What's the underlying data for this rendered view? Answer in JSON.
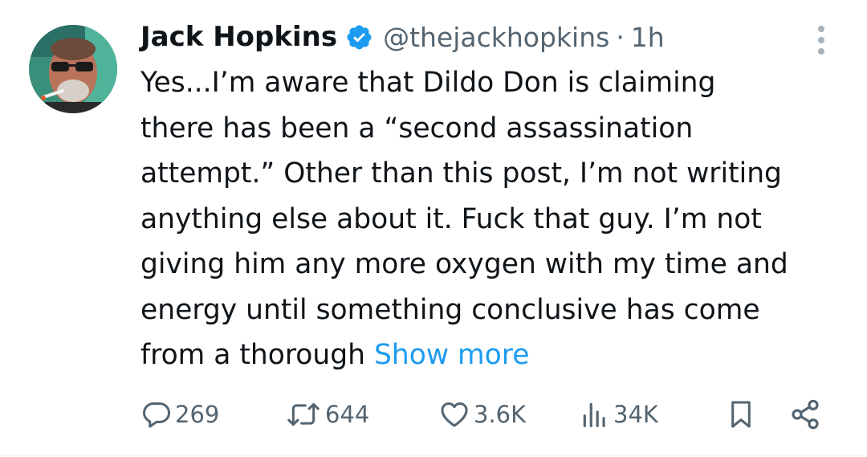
{
  "author": {
    "name": "Jack Hopkins",
    "handle": "@thejackhopkins",
    "separator": "·",
    "time": "1h",
    "verified": true
  },
  "tweet": {
    "text": "Yes...I’m aware that Dildo Don is claiming\nthere has been a “second assassination\nattempt.” Other than this post, I’m not writing\nanything else about it. Fuck that guy. I’m not\ngiving him any more oxygen with my time and\nenergy until something conclusive has come\nfrom a thorough ",
    "show_more": "Show more"
  },
  "actions": {
    "replies": "269",
    "reposts": "644",
    "likes": "3.6K",
    "views": "34K"
  },
  "icons": {
    "more": "more-vertical-icon",
    "reply": "reply-icon",
    "repost": "repost-icon",
    "like": "heart-icon",
    "views": "views-icon",
    "bookmark": "bookmark-icon",
    "share": "share-icon",
    "verified": "verified-badge-icon"
  },
  "colors": {
    "accent": "#1d9bf0",
    "text": "#0f1419",
    "secondary": "#536471"
  }
}
